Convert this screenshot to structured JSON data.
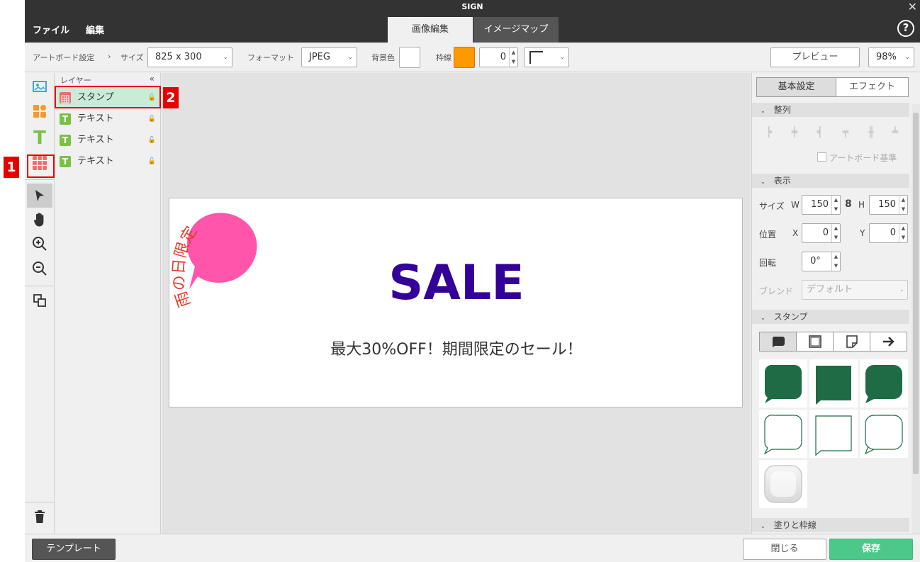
{
  "app": {
    "title": "SIGN"
  },
  "menu": {
    "file": "ファイル",
    "edit": "編集"
  },
  "main_tabs": {
    "image_edit": "画像編集",
    "image_map": "イメージマップ"
  },
  "help_label": "?",
  "toolbar": {
    "artboard_settings": "アートボード設定",
    "breadcrumb_sep": "›",
    "size_label": "サイズ",
    "size_value": "825 x 300",
    "format_label": "フォーマット",
    "format_value": "JPEG",
    "bg_label": "背景色",
    "border_label": "枠線",
    "border_color": "#ff9900",
    "border_width": "0",
    "preview": "プレビュー",
    "zoom": "98%"
  },
  "layers": {
    "header": "レイヤー",
    "collapse": "«",
    "items": [
      {
        "label": "スタンプ",
        "type": "stamp"
      },
      {
        "label": "テキスト",
        "type": "text"
      },
      {
        "label": "テキスト",
        "type": "text"
      },
      {
        "label": "テキスト",
        "type": "text"
      }
    ]
  },
  "artboard": {
    "headline": "SALE",
    "subtitle": "最大30%OFF！期間限定のセール！",
    "stamp_text": "雨の日限定",
    "headline_color": "#330099",
    "stamp_color": "#ff55aa",
    "stamp_text_color": "#e8382a"
  },
  "right_panel": {
    "tab_basic": "基本設定",
    "tab_effect": "エフェクト",
    "sec_align": "整列",
    "artboard_ref": "アートボード基準",
    "sec_display": "表示",
    "size_label": "サイズ",
    "w_label": "W",
    "w_value": "150",
    "h_label": "H",
    "h_value": "150",
    "pos_label": "位置",
    "x_label": "X",
    "x_value": "0",
    "y_label": "Y",
    "y_value": "0",
    "rotate_label": "回転",
    "rotate_value": "0°",
    "blend_label": "ブレンド",
    "blend_value": "デフォルト",
    "sec_stamp": "スタンプ",
    "sec_fill": "塗りと枠線",
    "stamp_color": "#1e6b45"
  },
  "bottom": {
    "template": "テンプレート",
    "close": "閉じる",
    "save": "保存",
    "save_color": "#4cc98a"
  },
  "markers": {
    "m1": "1",
    "m2": "2"
  }
}
